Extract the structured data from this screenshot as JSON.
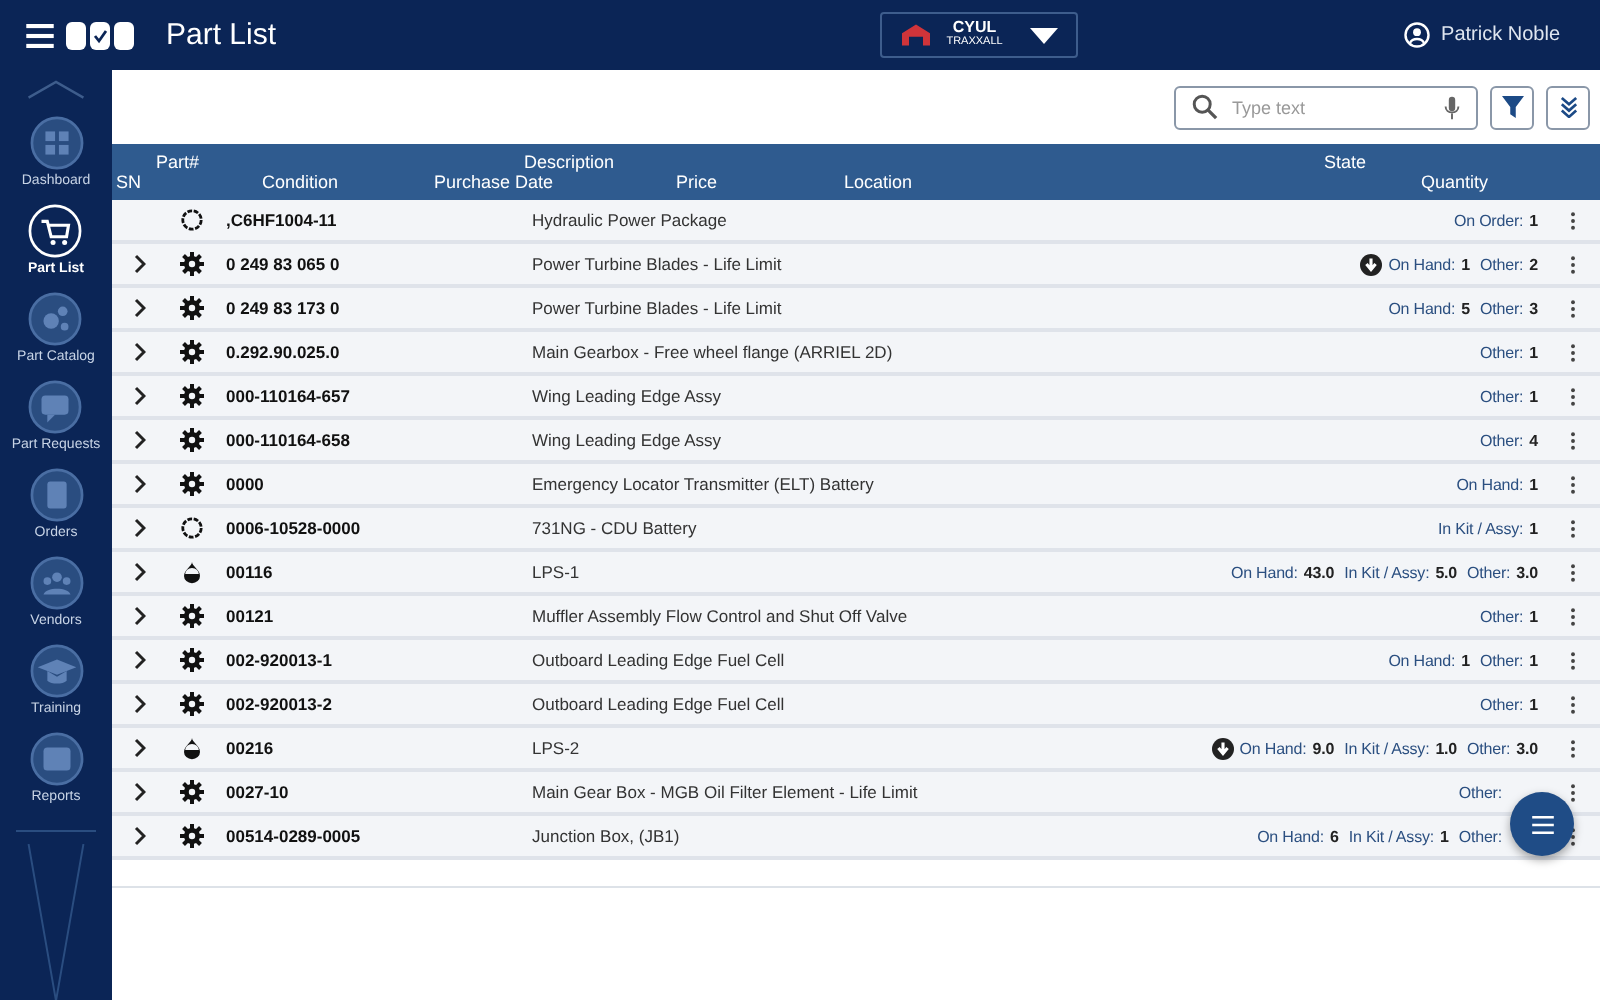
{
  "app_bar": {
    "title": "Part List",
    "location": {
      "code": "CYUL",
      "name": "TRAXXALL"
    },
    "user": "Patrick Noble"
  },
  "sidebar": {
    "items": [
      {
        "label": "Dashboard",
        "selected": false
      },
      {
        "label": "Part List",
        "selected": true
      },
      {
        "label": "Part Catalog",
        "selected": false
      },
      {
        "label": "Part Requests",
        "selected": false
      },
      {
        "label": "Orders",
        "selected": false
      },
      {
        "label": "Vendors",
        "selected": false
      },
      {
        "label": "Training",
        "selected": false
      },
      {
        "label": "Reports",
        "selected": false
      }
    ]
  },
  "search": {
    "placeholder": "Type text"
  },
  "table": {
    "columns_top": [
      "Part#",
      "Description",
      "State"
    ],
    "columns_bottom": [
      "SN",
      "Condition",
      "Purchase Date",
      "Price",
      "Location",
      "Quantity"
    ],
    "rows": [
      {
        "kind": "ring",
        "expandable": false,
        "part": ",C6HF1004-11",
        "description": "Hydraulic Power Package",
        "alert": false,
        "quantities": [
          {
            "label": "On Order:",
            "value": "1"
          }
        ]
      },
      {
        "kind": "gear",
        "expandable": true,
        "part": "0 249 83 065 0",
        "description": "Power Turbine Blades - Life Limit",
        "alert": true,
        "quantities": [
          {
            "label": "On Hand:",
            "value": "1"
          },
          {
            "label": "Other:",
            "value": "2"
          }
        ]
      },
      {
        "kind": "gear",
        "expandable": true,
        "part": "0 249 83 173 0",
        "description": "Power Turbine Blades - Life Limit",
        "alert": false,
        "quantities": [
          {
            "label": "On Hand:",
            "value": "5"
          },
          {
            "label": "Other:",
            "value": "3"
          }
        ]
      },
      {
        "kind": "gear",
        "expandable": true,
        "part": "0.292.90.025.0",
        "description": "Main Gearbox - Free wheel flange (ARRIEL 2D)",
        "alert": false,
        "quantities": [
          {
            "label": "Other:",
            "value": "1"
          }
        ]
      },
      {
        "kind": "gear",
        "expandable": true,
        "part": "000-110164-657",
        "description": "Wing Leading Edge Assy",
        "alert": false,
        "quantities": [
          {
            "label": "Other:",
            "value": "1"
          }
        ]
      },
      {
        "kind": "gear",
        "expandable": true,
        "part": "000-110164-658",
        "description": "Wing Leading Edge Assy",
        "alert": false,
        "quantities": [
          {
            "label": "Other:",
            "value": "4"
          }
        ]
      },
      {
        "kind": "gear",
        "expandable": true,
        "part": "0000",
        "description": "Emergency Locator Transmitter (ELT) Battery",
        "alert": false,
        "quantities": [
          {
            "label": "On Hand:",
            "value": "1"
          }
        ]
      },
      {
        "kind": "ring",
        "expandable": true,
        "part": "0006-10528-0000",
        "description": "731NG - CDU Battery",
        "alert": false,
        "quantities": [
          {
            "label": "In Kit / Assy:",
            "value": "1"
          }
        ]
      },
      {
        "kind": "drop",
        "expandable": true,
        "part": "00116",
        "description": "LPS-1",
        "alert": false,
        "quantities": [
          {
            "label": "On Hand:",
            "value": "43.0"
          },
          {
            "label": "In Kit / Assy:",
            "value": "5.0"
          },
          {
            "label": "Other:",
            "value": "3.0"
          }
        ]
      },
      {
        "kind": "gear",
        "expandable": true,
        "part": "00121",
        "description": "Muffler Assembly Flow Control and Shut Off Valve",
        "alert": false,
        "quantities": [
          {
            "label": "Other:",
            "value": "1"
          }
        ]
      },
      {
        "kind": "gear",
        "expandable": true,
        "part": "002-920013-1",
        "description": "Outboard Leading Edge Fuel Cell",
        "alert": false,
        "quantities": [
          {
            "label": "On Hand:",
            "value": "1"
          },
          {
            "label": "Other:",
            "value": "1"
          }
        ]
      },
      {
        "kind": "gear",
        "expandable": true,
        "part": "002-920013-2",
        "description": "Outboard Leading Edge Fuel Cell",
        "alert": false,
        "quantities": [
          {
            "label": "Other:",
            "value": "1"
          }
        ]
      },
      {
        "kind": "drop",
        "expandable": true,
        "part": "00216",
        "description": "LPS-2",
        "alert": true,
        "quantities": [
          {
            "label": "On Hand:",
            "value": "9.0"
          },
          {
            "label": "In Kit / Assy:",
            "value": "1.0"
          },
          {
            "label": "Other:",
            "value": "3.0"
          }
        ]
      },
      {
        "kind": "gear",
        "expandable": true,
        "part": "0027-10",
        "description": "Main Gear Box - MGB Oil Filter Element - Life Limit",
        "alert": false,
        "quantities": [
          {
            "label": "Other:"
          }
        ]
      },
      {
        "kind": "gear",
        "expandable": true,
        "part": "00514-0289-0005",
        "description": "Junction Box, (JB1)",
        "alert": false,
        "quantities": [
          {
            "label": "On Hand:",
            "value": "6"
          },
          {
            "label": "In Kit / Assy:",
            "value": "1"
          },
          {
            "label": "Other:"
          }
        ]
      }
    ]
  }
}
